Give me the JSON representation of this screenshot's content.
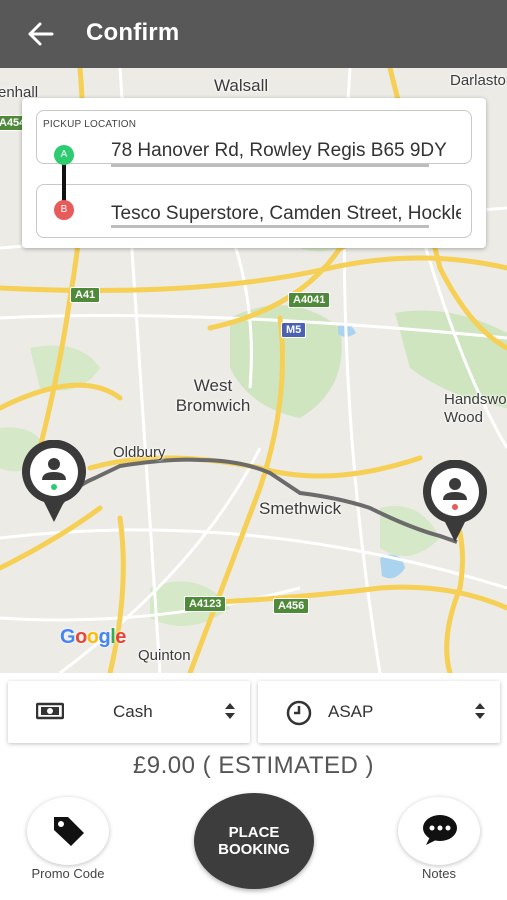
{
  "header": {
    "title": "Confirm"
  },
  "icons": {
    "back": "arrow-left-icon",
    "payment": "banknote-icon",
    "time": "clock-icon",
    "promo": "tag-icon",
    "notes": "chat-bubble-icon",
    "driver": "person-icon"
  },
  "colors": {
    "header_bg": "#585858",
    "pickup_pin": "#2ecc71",
    "dropoff_pin": "#e85b5b",
    "booking_btn": "#3d3d3d",
    "route": "#6b6b6b",
    "major_road": "#f6cf55"
  },
  "map": {
    "places": [
      "Walsall",
      "West Bromwich",
      "Oldbury",
      "Smethwick",
      "Quinton",
      "Handsworth Wood",
      "Darlaston",
      "enhall"
    ],
    "roads": [
      "A41",
      "A4041",
      "M5",
      "A4123",
      "A456",
      "A454"
    ],
    "attribution": "Google"
  },
  "locations": {
    "pickup_caption": "PICKUP LOCATION",
    "pickup_marker": "A",
    "dropoff_marker": "B",
    "pickup": "78 Hanover Rd, Rowley Regis B65 9DY",
    "dropoff": "Tesco Superstore, Camden Street, Hockley"
  },
  "options": {
    "payment_method": "Cash",
    "pickup_time": "ASAP"
  },
  "fare": "£9.00 ( ESTIMATED )",
  "actions": {
    "promo_label": "Promo Code",
    "booking_line1": "PLACE",
    "booking_line2": "BOOKING",
    "notes_label": "Notes"
  }
}
